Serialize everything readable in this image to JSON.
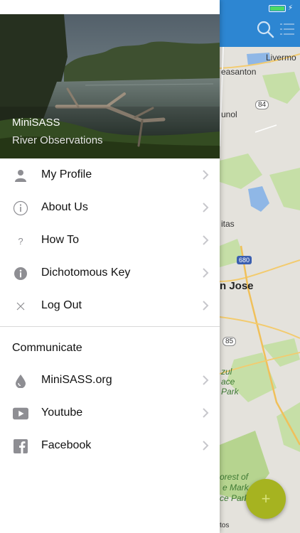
{
  "map": {
    "labels": {
      "livermore": "Livermo",
      "pleasanton": "easanton",
      "sunol": "unol",
      "route84": "84",
      "milpitas": "itas",
      "route680": "680",
      "sanjose": "n Jose",
      "route85": "85",
      "zul": "zul",
      "ace": "ace",
      "park": "Park",
      "forest": "orest of",
      "marks": "e Mark",
      "cepark": "ce Park",
      "tos": "tos"
    },
    "fab_label": "+"
  },
  "colors": {
    "map_topbar": "#2d86d2",
    "fab": "#a6b320",
    "icon_gray": "#8e8e93"
  },
  "hero": {
    "title": "MiniSASS",
    "subtitle": "River Observations"
  },
  "menu": [
    {
      "label": "My Profile",
      "icon": "person-icon"
    },
    {
      "label": "About Us",
      "icon": "info-circle-icon"
    },
    {
      "label": "How To",
      "icon": "question-icon"
    },
    {
      "label": "Dichotomous Key",
      "icon": "info-filled-icon"
    },
    {
      "label": "Log Out",
      "icon": "close-icon"
    }
  ],
  "communicate": {
    "header": "Communicate",
    "items": [
      {
        "label": "MiniSASS.org",
        "icon": "water-drop-icon"
      },
      {
        "label": "Youtube",
        "icon": "youtube-icon"
      },
      {
        "label": "Facebook",
        "icon": "facebook-icon"
      }
    ]
  }
}
